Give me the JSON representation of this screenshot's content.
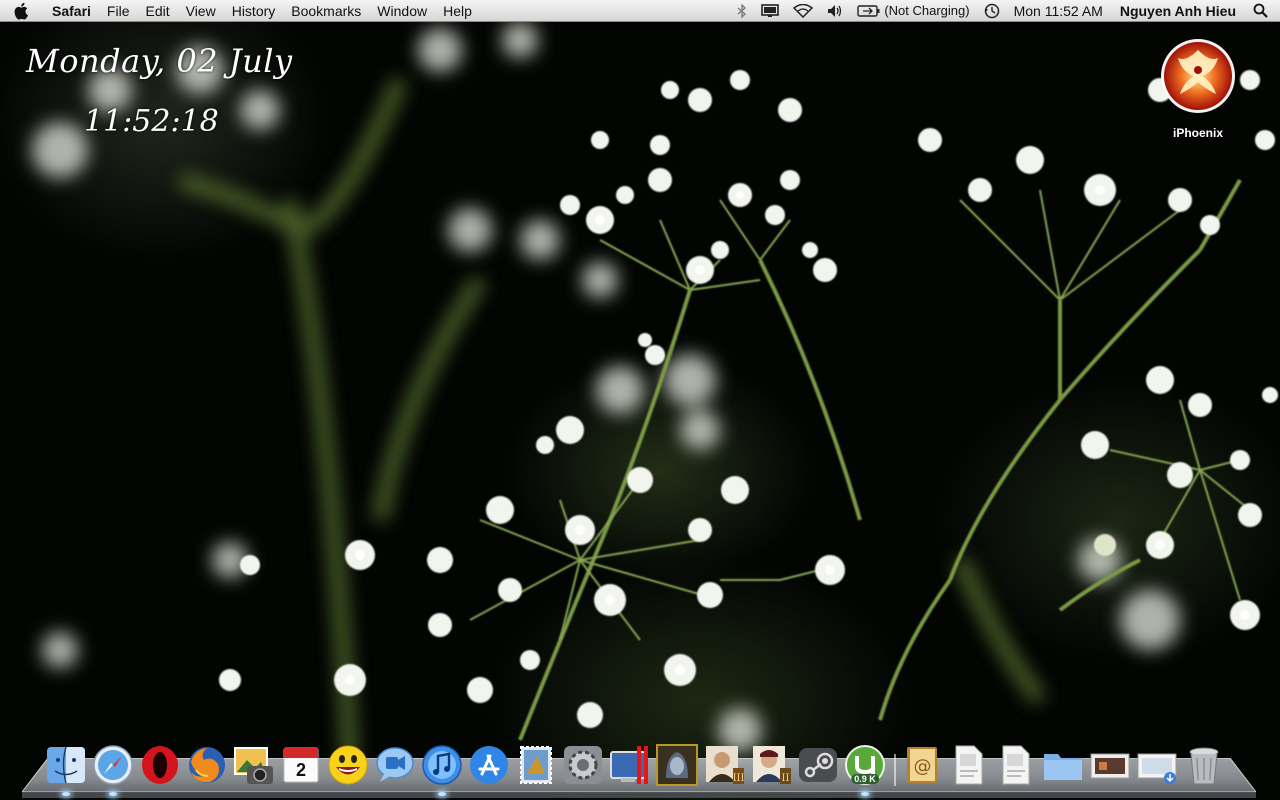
{
  "menubar": {
    "apple_icon": "apple-logo-icon",
    "app_name": "Safari",
    "menus": [
      "File",
      "Edit",
      "View",
      "History",
      "Bookmarks",
      "Window",
      "Help"
    ],
    "status": {
      "bluetooth_icon": "bluetooth-icon",
      "display_icon": "display-icon",
      "wifi_icon": "wifi-icon",
      "volume_icon": "volume-icon",
      "battery_icon": "battery-icon",
      "battery_status": "(Not Charging)",
      "timemachine_icon": "time-machine-icon",
      "clock": "Mon 11:52 AM",
      "user": "Nguyen Anh Hieu",
      "spotlight_icon": "spotlight-search-icon"
    }
  },
  "clock_widget": {
    "date": "Monday, 02 July",
    "time": "11:52:18"
  },
  "desktop": {
    "icons": [
      {
        "label": "iPhoenix",
        "icon": "phoenix-icon"
      }
    ]
  },
  "dock": {
    "apps": [
      {
        "name": "Finder",
        "icon": "finder-icon",
        "running": true
      },
      {
        "name": "Safari",
        "icon": "safari-icon",
        "running": true
      },
      {
        "name": "Opera",
        "icon": "opera-icon",
        "running": false
      },
      {
        "name": "Firefox",
        "icon": "firefox-icon",
        "running": false
      },
      {
        "name": "Image Capture",
        "icon": "image-capture-icon",
        "running": false
      },
      {
        "name": "iCal",
        "icon": "ical-icon",
        "running": false,
        "date_number": "2"
      },
      {
        "name": "Yahoo Messenger",
        "icon": "yahoo-messenger-icon",
        "running": false
      },
      {
        "name": "iChat",
        "icon": "ichat-icon",
        "running": false
      },
      {
        "name": "iTunes",
        "icon": "itunes-icon",
        "running": true
      },
      {
        "name": "App Store",
        "icon": "app-store-icon",
        "running": false
      },
      {
        "name": "Mail Stamp",
        "icon": "mail-stamp-icon",
        "running": false
      },
      {
        "name": "System Preferences",
        "icon": "system-preferences-icon",
        "running": false
      },
      {
        "name": "Parallels",
        "icon": "parallels-icon",
        "running": false
      },
      {
        "name": "Warcraft III",
        "icon": "warcraft-icon",
        "running": false
      },
      {
        "name": "Age of Empires III",
        "icon": "age-of-empires-icon",
        "running": false
      },
      {
        "name": "Age of Empires II",
        "icon": "age-of-empires-2-icon",
        "running": false
      },
      {
        "name": "Steam",
        "icon": "steam-icon",
        "running": false
      },
      {
        "name": "uTorrent",
        "icon": "utorrent-icon",
        "running": true,
        "badge": "0.9 K"
      }
    ],
    "stacks": [
      {
        "name": "Address Book",
        "icon": "address-book-icon"
      },
      {
        "name": "PDF Document",
        "icon": "pdf-file-icon"
      },
      {
        "name": "PDF Document 2",
        "icon": "pdf-file-icon"
      },
      {
        "name": "Applications",
        "icon": "folder-icon"
      },
      {
        "name": "Movie",
        "icon": "movie-file-icon"
      },
      {
        "name": "Downloads",
        "icon": "downloads-stack-icon"
      },
      {
        "name": "Trash",
        "icon": "trash-icon"
      }
    ]
  },
  "colors": {
    "menubar": "#e6e6e6",
    "running_indicator": "#bfe4ff",
    "wallpaper_flowers": "#f4f6f2",
    "wallpaper_stems": "#6b8a3a"
  }
}
